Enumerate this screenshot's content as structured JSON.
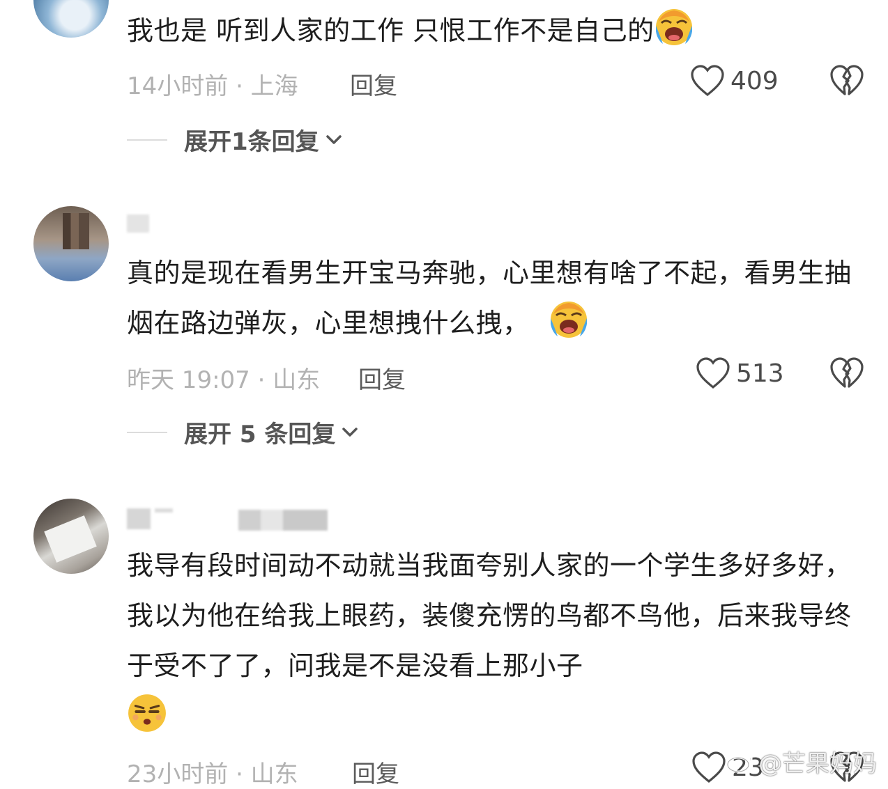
{
  "comments": [
    {
      "username": "",
      "text": "我也是 听到人家的工作 只恨工作不是自己的",
      "emoji": "laughing-crying-emoji",
      "time": "14小时前 · 上海",
      "reply_label": "回复",
      "likes": "409",
      "expand_label": "展开1条回复"
    },
    {
      "username": "",
      "text": "真的是现在看男生开宝马奔驰，心里想有啥了不起，看男生抽烟在路边弹灰，心里想拽什么拽，",
      "emoji": "laughing-crying-emoji",
      "time": "昨天 19:07 · 山东",
      "reply_label": "回复",
      "likes": "513",
      "expand_label": "展开 5 条回复"
    },
    {
      "username": "",
      "text": "我导有段时间动不动就当我面夸别人家的一个学生多好多好，我以为他在给我上眼药，装傻充愣的鸟都不鸟他，后来我导终于受不了了，问我是不是没看上那小子",
      "emoji": "unamused-face-emoji",
      "time": "23小时前 · 山东",
      "reply_label": "回复",
      "likes": "23"
    }
  ],
  "watermark": "@芒果妈妈",
  "colors": {
    "text": "#1e1e1e",
    "meta": "#b2b2b2",
    "reply": "#5b5b5b",
    "icon": "#4a4a4a",
    "emoji_yellow": "#f6c33a",
    "emoji_blue": "#49a7e8"
  }
}
